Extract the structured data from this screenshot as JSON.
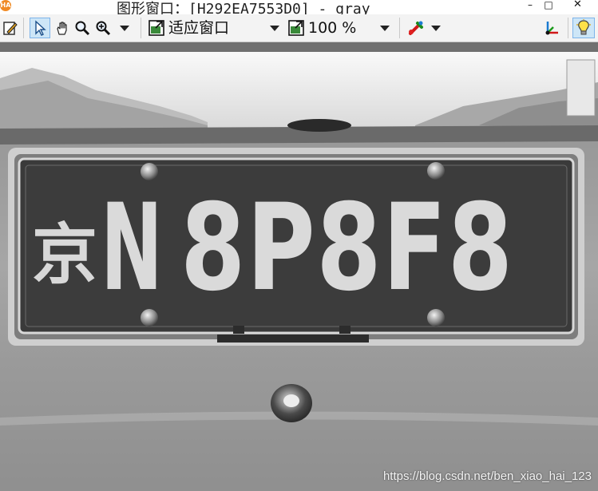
{
  "window": {
    "app_badge": "HA",
    "title": "图形窗口：[H292EA7553D0] - gray",
    "minimize_glyph": "–",
    "maximize_glyph": "□",
    "close_glyph": "✕"
  },
  "toolbar": {
    "fit_label": "适应窗口",
    "zoom_label": "100 %",
    "icons": [
      "edit-icon",
      "pointer-icon",
      "hand-pan-icon",
      "magnifier-icon",
      "zoom-in-icon",
      "fit-window-icon",
      "zoom-level-icon",
      "color-picker-icon",
      "axes-icon",
      "lightbulb-icon"
    ]
  },
  "image": {
    "plate": {
      "province": "京",
      "letter": "N",
      "serial": "8P8F8"
    },
    "watermark": "https://blog.csdn.net/ben_xiao_hai_123"
  }
}
